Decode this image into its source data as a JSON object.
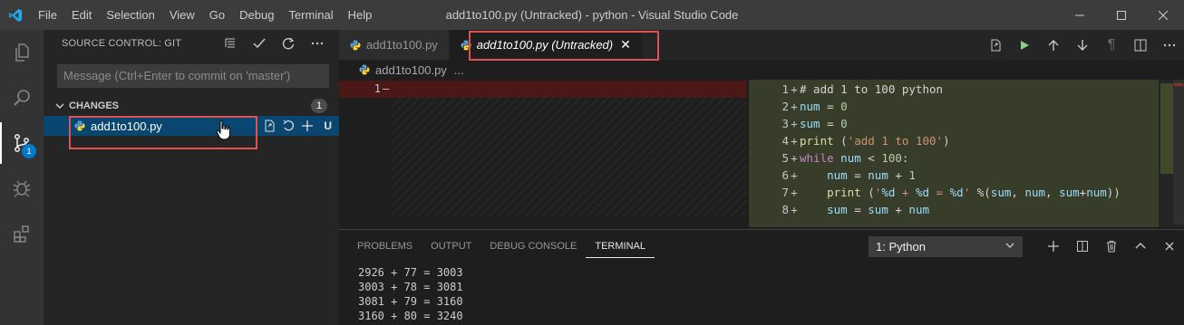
{
  "window": {
    "title": "add1to100.py (Untracked) - python - Visual Studio Code",
    "menu": [
      "File",
      "Edit",
      "Selection",
      "View",
      "Go",
      "Debug",
      "Terminal",
      "Help"
    ],
    "logo_icon": "vscode-logo-icon",
    "controls": [
      "minimize-icon",
      "maximize-icon",
      "close-icon"
    ]
  },
  "activity_bar": {
    "items": [
      {
        "icon": "explorer-icon"
      },
      {
        "icon": "search-icon"
      },
      {
        "icon": "source-control-icon",
        "badge": "1",
        "active": true
      },
      {
        "icon": "debug-icon"
      },
      {
        "icon": "extensions-icon"
      }
    ]
  },
  "sidebar": {
    "title": "SOURCE CONTROL: GIT",
    "actions": [
      "view-as-tree-icon",
      "commit-check-icon",
      "refresh-icon",
      "more-actions-icon"
    ],
    "commit_placeholder": "Message (Ctrl+Enter to commit on 'master')",
    "changes_label": "CHANGES",
    "changes_count": "1",
    "files": [
      {
        "name": "add1to100.py",
        "status": "U"
      }
    ]
  },
  "editor": {
    "tabs": [
      {
        "label": "add1to100.py",
        "active": false
      },
      {
        "label": "add1to100.py (Untracked)",
        "active": true
      }
    ],
    "breadcrumb": {
      "file": "add1to100.py",
      "more": "..."
    },
    "actions": [
      "open-file-icon",
      "run-icon",
      "arrow-up-icon",
      "arrow-down-icon",
      "pilcrow-icon",
      "split-editor-icon",
      "more-actions-icon"
    ],
    "left": {
      "line": "1",
      "sign": "—"
    },
    "right_lines": [
      {
        "n": "1",
        "text": "# add 1 to 100 python"
      },
      {
        "n": "2",
        "text": "num = 0"
      },
      {
        "n": "3",
        "text": "sum = 0"
      },
      {
        "n": "4",
        "text": "print ('add 1 to 100')"
      },
      {
        "n": "5",
        "text": "while num < 100:"
      },
      {
        "n": "6",
        "text": "    num = num + 1"
      },
      {
        "n": "7",
        "text": "    print ('%d + %d = %d' %(sum, num, sum+num))"
      },
      {
        "n": "8",
        "text": "    sum = sum + num"
      }
    ]
  },
  "panel": {
    "tabs": [
      "PROBLEMS",
      "OUTPUT",
      "DEBUG CONSOLE",
      "TERMINAL"
    ],
    "active_tab": "TERMINAL",
    "terminal_select": "1: Python",
    "actions": [
      "new-terminal-icon",
      "split-terminal-icon",
      "trash-icon",
      "maximize-panel-icon",
      "close-panel-icon"
    ],
    "terminal_lines": [
      "2926 + 77 = 3003",
      "3003 + 78 = 3081",
      "3081 + 79 = 3160",
      "3160 + 80 = 3240"
    ]
  },
  "colors": {
    "accent": "#007acc",
    "highlight": "#e05252",
    "selection": "#094771",
    "deleted": "#4b1818",
    "inserted": "#373d29"
  }
}
